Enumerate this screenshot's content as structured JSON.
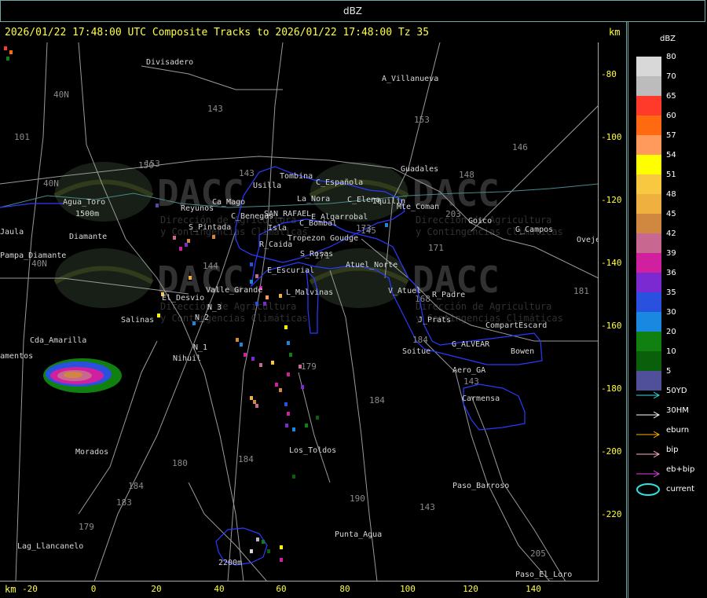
{
  "window": {
    "title": "dBZ"
  },
  "header": {
    "text": "2026/01/22 17:48:00 UTC Composite Tracks to 2026/01/22 17:48:00 Tz 35",
    "km_top": "km",
    "km_bottom": "km"
  },
  "axes": {
    "y_ticks": [
      "-80",
      "-100",
      "-120",
      "-140",
      "-160",
      "-180",
      "-200",
      "-220"
    ],
    "x_ticks": [
      "-20",
      "0",
      "20",
      "40",
      "60",
      "80",
      "100",
      "120",
      "140"
    ]
  },
  "legend": {
    "title": "dBZ",
    "scale": [
      {
        "value": "80",
        "color": "#d8d8d8"
      },
      {
        "value": "70",
        "color": "#bcbcbc"
      },
      {
        "value": "65",
        "color": "#ff3a2a"
      },
      {
        "value": "60",
        "color": "#ff6a10"
      },
      {
        "value": "57",
        "color": "#ff9a5c"
      },
      {
        "value": "54",
        "color": "#ffff00"
      },
      {
        "value": "51",
        "color": "#f8c840"
      },
      {
        "value": "48",
        "color": "#f0b040"
      },
      {
        "value": "45",
        "color": "#d08840"
      },
      {
        "value": "42",
        "color": "#c86890"
      },
      {
        "value": "39",
        "color": "#d020a0"
      },
      {
        "value": "36",
        "color": "#7a2ad0"
      },
      {
        "value": "35",
        "color": "#2a50e0"
      },
      {
        "value": "30",
        "color": "#1888e0"
      },
      {
        "value": "20",
        "color": "#108010"
      },
      {
        "value": "10",
        "color": "#0a600a"
      },
      {
        "value": "5",
        "color": "#50509a"
      }
    ],
    "tracks": [
      {
        "label": "50YD",
        "color": "#30e0e0"
      },
      {
        "label": "30HM",
        "color": "#ffffff"
      },
      {
        "label": "eburn",
        "color": "#ffb000"
      },
      {
        "label": "bip",
        "color": "#ffb0c8"
      },
      {
        "label": "eb+bip",
        "color": "#e040e0"
      },
      {
        "label": "current",
        "color": "#30e0e0"
      }
    ]
  },
  "map": {
    "watermark": {
      "brand": "DACC",
      "line1": "Dirección de Agricultura",
      "line2": "y Contingencias Climáticas"
    },
    "places": [
      {
        "name": "Divisadero"
      },
      {
        "name": "A_Villanueva"
      },
      {
        "name": "Guadales"
      },
      {
        "name": "Tombina"
      },
      {
        "name": "Usilla"
      },
      {
        "name": "C_Española"
      },
      {
        "name": "La_Nora"
      },
      {
        "name": "C_Elena"
      },
      {
        "name": "Iquilin"
      },
      {
        "name": "Mte_Coman"
      },
      {
        "name": "Goico"
      },
      {
        "name": "G_Campos"
      },
      {
        "name": "Ovejer"
      },
      {
        "name": "Agua_Toro"
      },
      {
        "name": "Reyunos"
      },
      {
        "name": "Ca_Mago"
      },
      {
        "name": "C_Benegas"
      },
      {
        "name": "SAN_RAFAEL"
      },
      {
        "name": "E_Algarrobal"
      },
      {
        "name": "C_Bombal"
      },
      {
        "name": "S_Pintada"
      },
      {
        "name": "Isla"
      },
      {
        "name": "Tropezon"
      },
      {
        "name": "Goudge"
      },
      {
        "name": "Jaula"
      },
      {
        "name": "Diamante"
      },
      {
        "name": "Pampa_Diamante"
      },
      {
        "name": "R_Caida"
      },
      {
        "name": "S_Rosas"
      },
      {
        "name": "Atuel_Norte"
      },
      {
        "name": "E_Escurial"
      },
      {
        "name": "Valle_Grande"
      },
      {
        "name": "L_Malvinas"
      },
      {
        "name": "V_Atuel"
      },
      {
        "name": "R_Padre"
      },
      {
        "name": "El_Desvio"
      },
      {
        "name": "N_3"
      },
      {
        "name": "Salinas"
      },
      {
        "name": "N_2"
      },
      {
        "name": "J_Prats"
      },
      {
        "name": "CompartEscard"
      },
      {
        "name": "Cda_Amarilla"
      },
      {
        "name": "N_1"
      },
      {
        "name": "G_ALVEAR"
      },
      {
        "name": "Nihuil"
      },
      {
        "name": "Soitue"
      },
      {
        "name": "Bowen"
      },
      {
        "name": "Aero_GA"
      },
      {
        "name": "amentos"
      },
      {
        "name": "Carmensa"
      },
      {
        "name": "Morados"
      },
      {
        "name": "Los_Toldos"
      },
      {
        "name": "Paso_Barroso"
      },
      {
        "name": "Punta_Agua"
      },
      {
        "name": "Lag_Llancanelo"
      },
      {
        "name": "Paso_El_Loro"
      },
      {
        "name": "1500m"
      },
      {
        "name": "2200m"
      }
    ],
    "route_labels": [
      "143",
      "153",
      "146",
      "148",
      "150",
      "143",
      "101",
      "40N",
      "40N",
      "40N",
      "173",
      "171",
      "203",
      "153",
      "168",
      "171",
      "145",
      "144",
      "179",
      "184",
      "180",
      "184",
      "184",
      "183",
      "179",
      "190",
      "143",
      "143",
      "205",
      "181",
      "184"
    ]
  }
}
